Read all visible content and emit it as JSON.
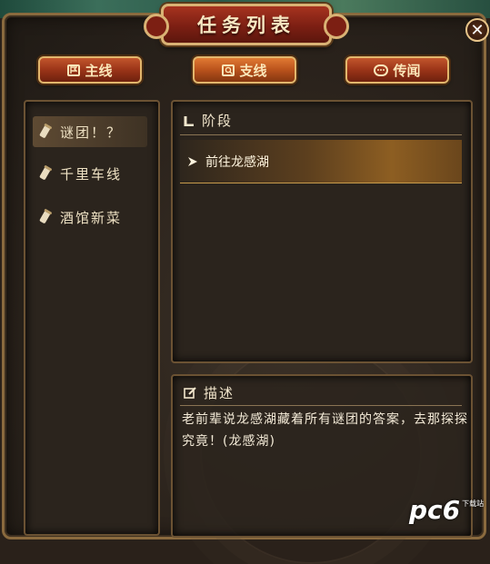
{
  "window": {
    "title": "任务列表",
    "close_symbol": "✕"
  },
  "tabs": [
    {
      "label": "主线",
      "icon": "flag-icon",
      "active": false
    },
    {
      "label": "支线",
      "icon": "magnifier-icon",
      "active": true
    },
    {
      "label": "传闻",
      "icon": "speech-bubble-icon",
      "active": false
    }
  ],
  "quest_list": [
    {
      "label": "谜团！？",
      "icon": "scroll-icon",
      "selected": true
    },
    {
      "label": "千里车线",
      "icon": "scroll-icon",
      "selected": false
    },
    {
      "label": "酒馆新菜",
      "icon": "scroll-icon",
      "selected": false
    }
  ],
  "stage": {
    "heading": "阶段",
    "current": "前往龙感湖"
  },
  "description": {
    "heading": "描述",
    "text": "老前辈说龙感湖藏着所有谜团的答案，去那探探究竟！(龙感湖)"
  },
  "watermark": {
    "brand": "pc6",
    "sub": "下载站"
  },
  "colors": {
    "accent": "#e2b66c",
    "tab_red": "#9a3418",
    "panel_bg": "#2b241d"
  }
}
